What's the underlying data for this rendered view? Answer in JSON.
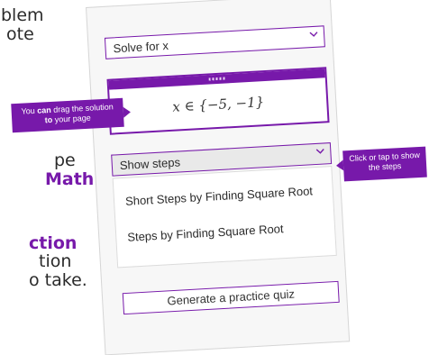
{
  "background_text": {
    "line1": "blem",
    "line2": "ote",
    "line3": "pe",
    "line4_bold": "Math",
    "line5_bold": "ction",
    "line6": "tion",
    "line7": "o take."
  },
  "panel": {
    "solve_select": {
      "value": "Solve for x"
    },
    "solution": {
      "math": "x ∈ {−5, −1}"
    },
    "steps_select": {
      "value": "Show steps"
    },
    "steps_options": [
      "Short Steps by Finding Square Root",
      "Steps by Finding Square Root"
    ],
    "quiz_button": "Generate a practice quiz"
  },
  "callouts": {
    "drag_pre": "You ",
    "drag_can": "can",
    "drag_mid": " drag the solution ",
    "drag_to": "to",
    "drag_post": " your page",
    "steps": "Click or tap to show the steps"
  },
  "colors": {
    "accent": "#7719aa",
    "panel_bg": "#f7f7f7"
  },
  "icons": [
    "chevron-down-icon",
    "drag-handle-icon"
  ]
}
